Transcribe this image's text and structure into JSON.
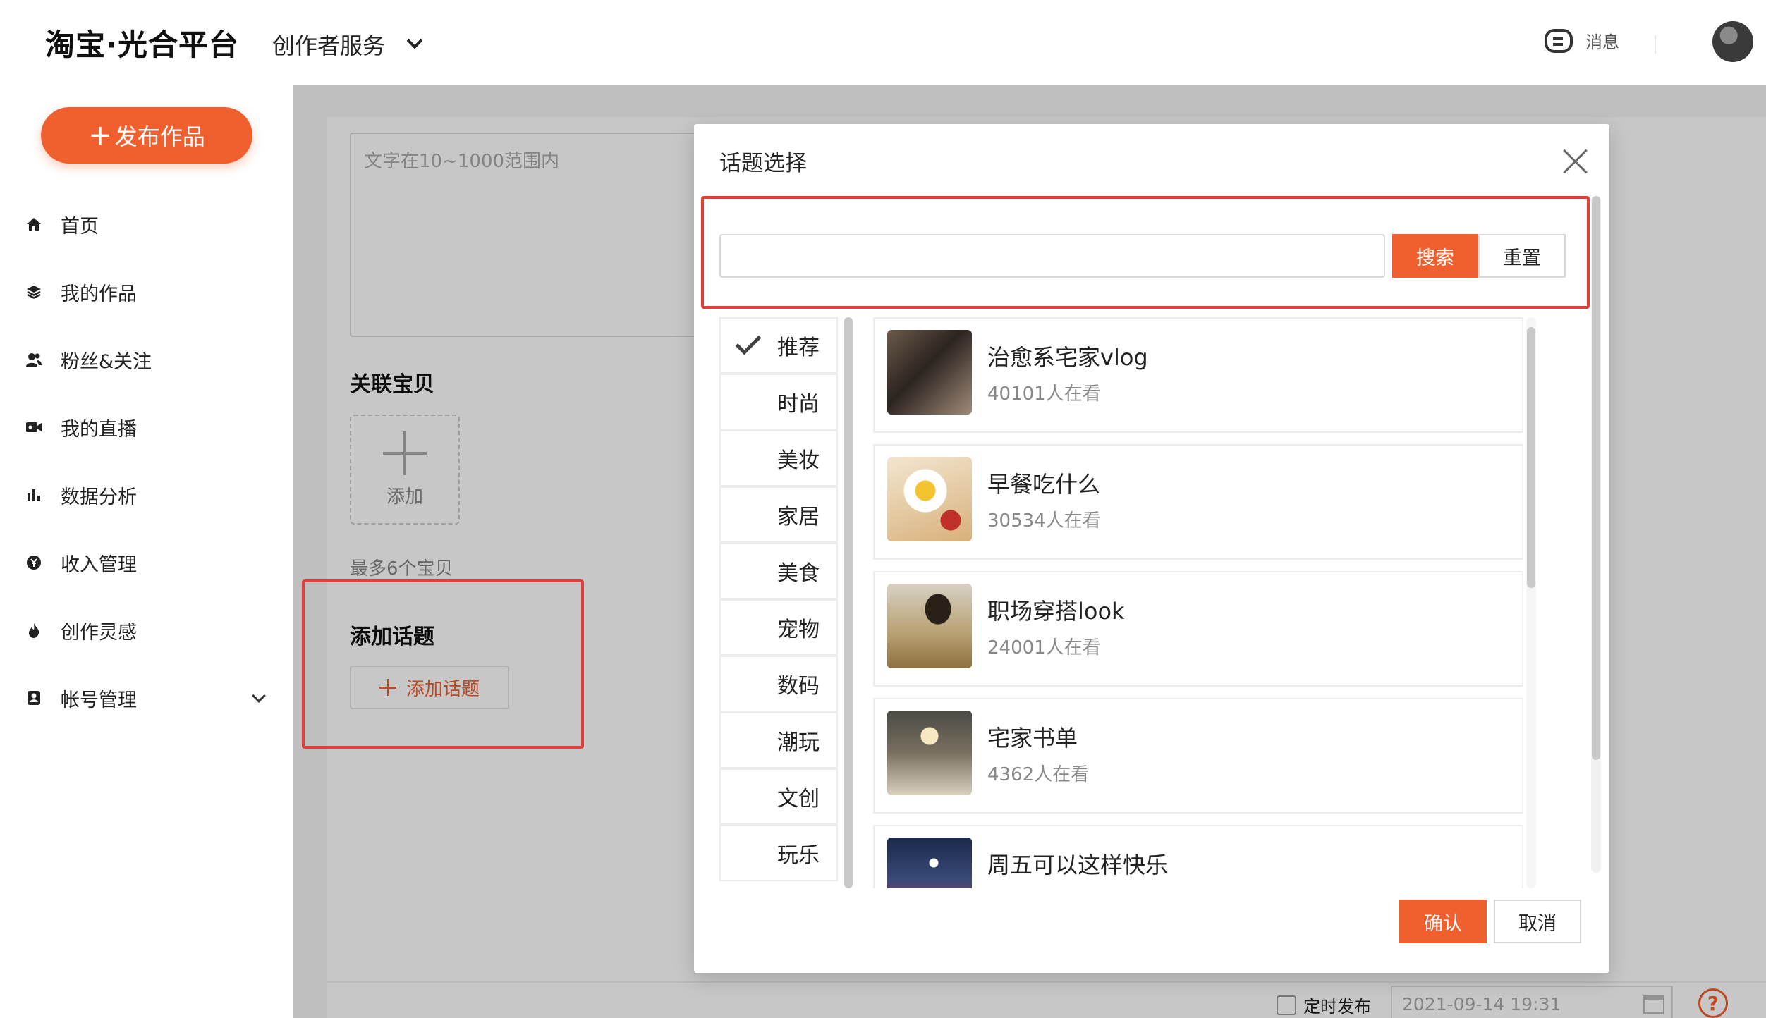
{
  "header": {
    "logo": "淘宝·光合平台",
    "service_menu": "创作者服务",
    "messages_label": "消息",
    "accent_color": "#f0602f"
  },
  "sidebar": {
    "publish_label": "发布作品",
    "items": [
      {
        "label": "首页",
        "icon": "home-icon"
      },
      {
        "label": "我的作品",
        "icon": "layers-icon"
      },
      {
        "label": "粉丝&关注",
        "icon": "users-icon"
      },
      {
        "label": "我的直播",
        "icon": "video-icon"
      },
      {
        "label": "数据分析",
        "icon": "bar-chart-icon"
      },
      {
        "label": "收入管理",
        "icon": "money-icon"
      },
      {
        "label": "创作灵感",
        "icon": "flame-icon"
      },
      {
        "label": "帐号管理",
        "icon": "account-icon"
      }
    ]
  },
  "form": {
    "description_placeholder": "文字在10~1000范围内",
    "related_items_title": "关联宝贝",
    "add_item_label": "添加",
    "max_items_hint": "最多6个宝贝",
    "add_topic_title": "添加话题",
    "add_topic_button": "添加话题",
    "schedule_label": "定时发布",
    "schedule_datetime": "2021-09-14 19:31"
  },
  "modal": {
    "title": "话题选择",
    "search_value": "",
    "search_button": "搜索",
    "reset_button": "重置",
    "categories": [
      "推荐",
      "时尚",
      "美妆",
      "家居",
      "美食",
      "宠物",
      "数码",
      "潮玩",
      "文创",
      "玩乐"
    ],
    "selected_category": "推荐",
    "topics": [
      {
        "name": "治愈系宅家vlog",
        "count": "40101人在看"
      },
      {
        "name": "早餐吃什么",
        "count": "30534人在看"
      },
      {
        "name": "职场穿搭look",
        "count": "24001人在看"
      },
      {
        "name": "宅家书单",
        "count": "4362人在看"
      },
      {
        "name": "周五可以这样快乐",
        "count": ""
      }
    ],
    "confirm_button": "确认",
    "cancel_button": "取消"
  }
}
